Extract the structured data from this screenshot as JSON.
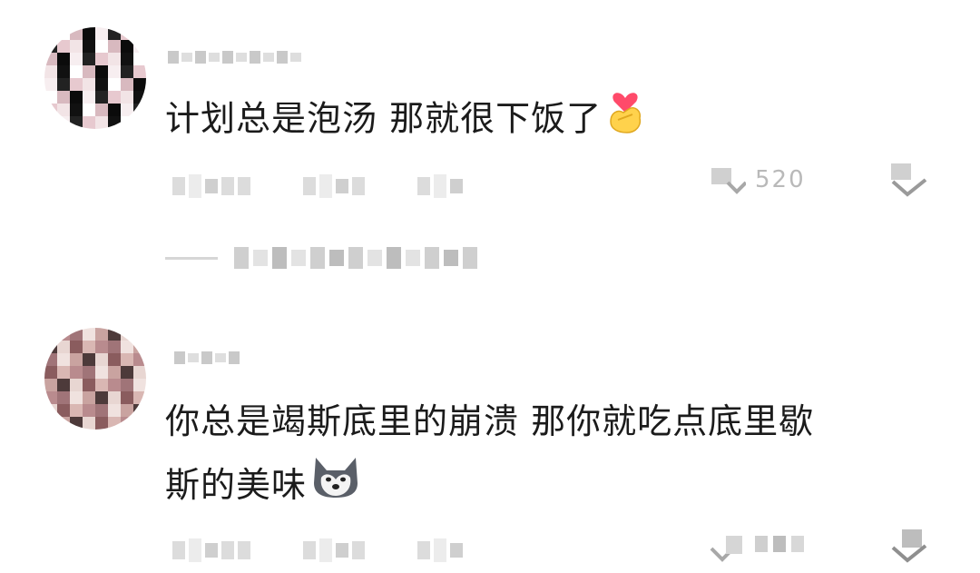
{
  "comments": [
    {
      "text_lines": [
        "计划总是泡汤 那就很下饭了"
      ],
      "emoji": "heart-hand-emoji",
      "like_count": "520",
      "avatar_colors": [
        "#111111",
        "#f2e4e6",
        "#e7c9cf",
        "#222222",
        "#f7eef0",
        "#0b0b0b",
        "#d8b9bf",
        "#ffffff"
      ]
    },
    {
      "text_lines": [
        "你总是竭斯底里的崩溃 那你就吃点底里歇",
        "斯的美味"
      ],
      "emoji": "husky-dog-emoji",
      "like_count": "",
      "avatar_colors": [
        "#b98b8e",
        "#d9b7b3",
        "#8a5c5e",
        "#e8d6d2",
        "#4d3a3a",
        "#c9a3a0",
        "#f0e2df",
        "#a07478"
      ]
    }
  ],
  "colors": {
    "text": "#1b1b1b",
    "muted": "#b9b9b9",
    "background": "#ffffff"
  }
}
